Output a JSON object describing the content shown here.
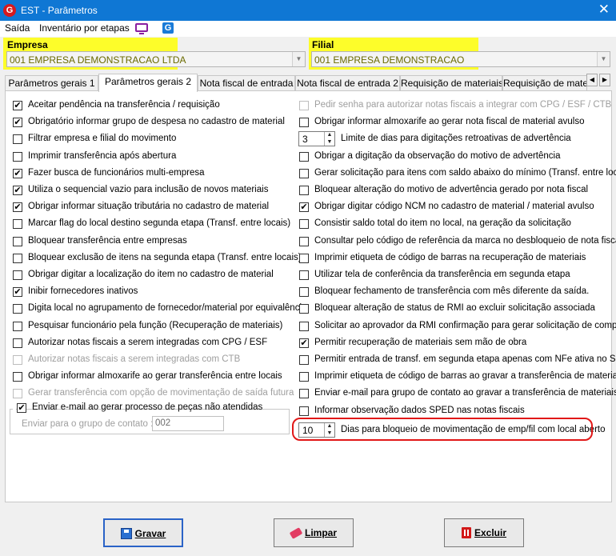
{
  "window": {
    "title": "EST - Parâmetros",
    "close_glyph": "✕"
  },
  "menu": {
    "items": [
      "Saída",
      "Inventário por etapas"
    ]
  },
  "empresa": {
    "label": "Empresa",
    "value": "001 EMPRESA DEMONSTRACAO LTDA"
  },
  "filial": {
    "label": "Filial",
    "value": "001 EMPRESA DEMONSTRACAO"
  },
  "tabs": [
    {
      "label": "Parâmetros gerais 1",
      "active": false
    },
    {
      "label": "Parâmetros gerais 2",
      "active": true
    },
    {
      "label": "Nota fiscal de entrada",
      "active": false
    },
    {
      "label": "Nota fiscal de entrada 2",
      "active": false
    },
    {
      "label": "Requisição de materiais",
      "active": false
    },
    {
      "label": "Requisição de materi",
      "active": false
    }
  ],
  "left_options": [
    {
      "label": "Aceitar pendência na transferência / requisição",
      "checked": true,
      "enabled": true
    },
    {
      "label": "Obrigatório informar grupo de despesa no cadastro de material",
      "checked": true,
      "enabled": true
    },
    {
      "label": "Filtrar empresa e filial do movimento",
      "checked": false,
      "enabled": true
    },
    {
      "label": "Imprimir transferência após abertura",
      "checked": false,
      "enabled": true
    },
    {
      "label": "Fazer busca de funcionários multi-empresa",
      "checked": true,
      "enabled": true
    },
    {
      "label": "Utiliza o sequencial vazio para inclusão de novos materiais",
      "checked": true,
      "enabled": true
    },
    {
      "label": "Obrigar informar situação tributária no cadastro de material",
      "checked": true,
      "enabled": true
    },
    {
      "label": "Marcar flag do local destino segunda etapa (Transf. entre locais)",
      "checked": false,
      "enabled": true
    },
    {
      "label": "Bloquear transferência entre empresas",
      "checked": false,
      "enabled": true
    },
    {
      "label": "Bloquear exclusão de itens na segunda etapa (Transf. entre locais)",
      "checked": false,
      "enabled": true
    },
    {
      "label": "Obrigar digitar a localização do item no cadastro de material",
      "checked": false,
      "enabled": true
    },
    {
      "label": "Inibir fornecedores inativos",
      "checked": true,
      "enabled": true
    },
    {
      "label": "Digita local no agrupamento de fornecedor/material por equivalência",
      "checked": false,
      "enabled": true
    },
    {
      "label": "Pesquisar funcionário pela função (Recuperação de materiais)",
      "checked": false,
      "enabled": true
    },
    {
      "label": "Autorizar notas fiscais a serem integradas com CPG / ESF",
      "checked": false,
      "enabled": true
    },
    {
      "label": "Autorizar notas fiscais a serem integradas com CTB",
      "checked": false,
      "enabled": false
    },
    {
      "label": "Obrigar informar almoxarife ao gerar transferência entre locais",
      "checked": false,
      "enabled": true
    },
    {
      "label": "Gerar transferência com opção de movimentação de saída futura",
      "checked": false,
      "enabled": false
    }
  ],
  "email_group": {
    "label": "Enviar e-mail ao gerar processo de peças não atendidas",
    "checked": true,
    "input_label": "Enviar para o grupo de contato :",
    "input_value": "002"
  },
  "right_options": [
    {
      "type": "check",
      "label": "Pedir senha para autorizar notas fiscais a integrar com CPG / ESF / CTB",
      "checked": false,
      "enabled": false
    },
    {
      "type": "check",
      "label": "Obrigar informar almoxarife ao gerar nota fiscal de material avulso",
      "checked": false,
      "enabled": true
    },
    {
      "type": "spin",
      "label": "Limite de dias para digitações retroativas de advertência",
      "value": "3"
    },
    {
      "type": "check",
      "label": "Obrigar a digitação da observação do motivo de advertência",
      "checked": false,
      "enabled": true
    },
    {
      "type": "check",
      "label": "Gerar solicitação para itens com saldo abaixo do mínimo (Transf. entre locais)",
      "checked": false,
      "enabled": true
    },
    {
      "type": "check",
      "label": "Bloquear alteração do motivo de advertência gerado por nota fiscal",
      "checked": false,
      "enabled": true
    },
    {
      "type": "check",
      "label": "Obrigar digitar código NCM no cadastro de material / material avulso",
      "checked": true,
      "enabled": true
    },
    {
      "type": "check",
      "label": "Consistir saldo total do item no local, na geração da solicitação",
      "checked": false,
      "enabled": true
    },
    {
      "type": "check",
      "label": "Consultar pelo código de referência da marca no desbloqueio de nota fiscal",
      "checked": false,
      "enabled": true
    },
    {
      "type": "check",
      "label": "Imprimir etiqueta de código de barras na recuperação de materiais",
      "checked": false,
      "enabled": true
    },
    {
      "type": "check",
      "label": "Utilizar tela de conferência da transferência em segunda etapa",
      "checked": false,
      "enabled": true
    },
    {
      "type": "check",
      "label": "Bloquear fechamento de transferência com mês diferente da saída.",
      "checked": false,
      "enabled": true
    },
    {
      "type": "check",
      "label": "Bloquear alteração de status de RMI ao excluir solicitação associada",
      "checked": false,
      "enabled": true
    },
    {
      "type": "check",
      "label": "Solicitar ao aprovador da RMI confirmação para gerar solicitação de compra",
      "checked": false,
      "enabled": true
    },
    {
      "type": "check",
      "label": "Permitir recuperação de materiais sem mão de obra",
      "checked": true,
      "enabled": true
    },
    {
      "type": "check",
      "label": "Permitir entrada de transf. em segunda etapa apenas com NFe ativa no Sefaz",
      "checked": false,
      "enabled": true
    },
    {
      "type": "check",
      "label": "Imprimir etiqueta de código de barras ao gravar a transferência de materiais",
      "checked": false,
      "enabled": true
    },
    {
      "type": "check",
      "label": "Enviar e-mail para grupo de contato ao gravar a transferência de materiais",
      "checked": false,
      "enabled": true
    },
    {
      "type": "check",
      "label": "Informar observação dados SPED nas notas fiscais",
      "checked": false,
      "enabled": true
    },
    {
      "type": "spin",
      "label": "Dias para bloqueio de movimentação de emp/fil com local aberto",
      "value": "10"
    }
  ],
  "buttons": {
    "save": "Gravar",
    "clear": "Limpar",
    "delete": "Excluir"
  },
  "colors": {
    "titlebar": "#0f77d4",
    "highlight": "#fdfd2a",
    "annotation": "#e11818"
  }
}
